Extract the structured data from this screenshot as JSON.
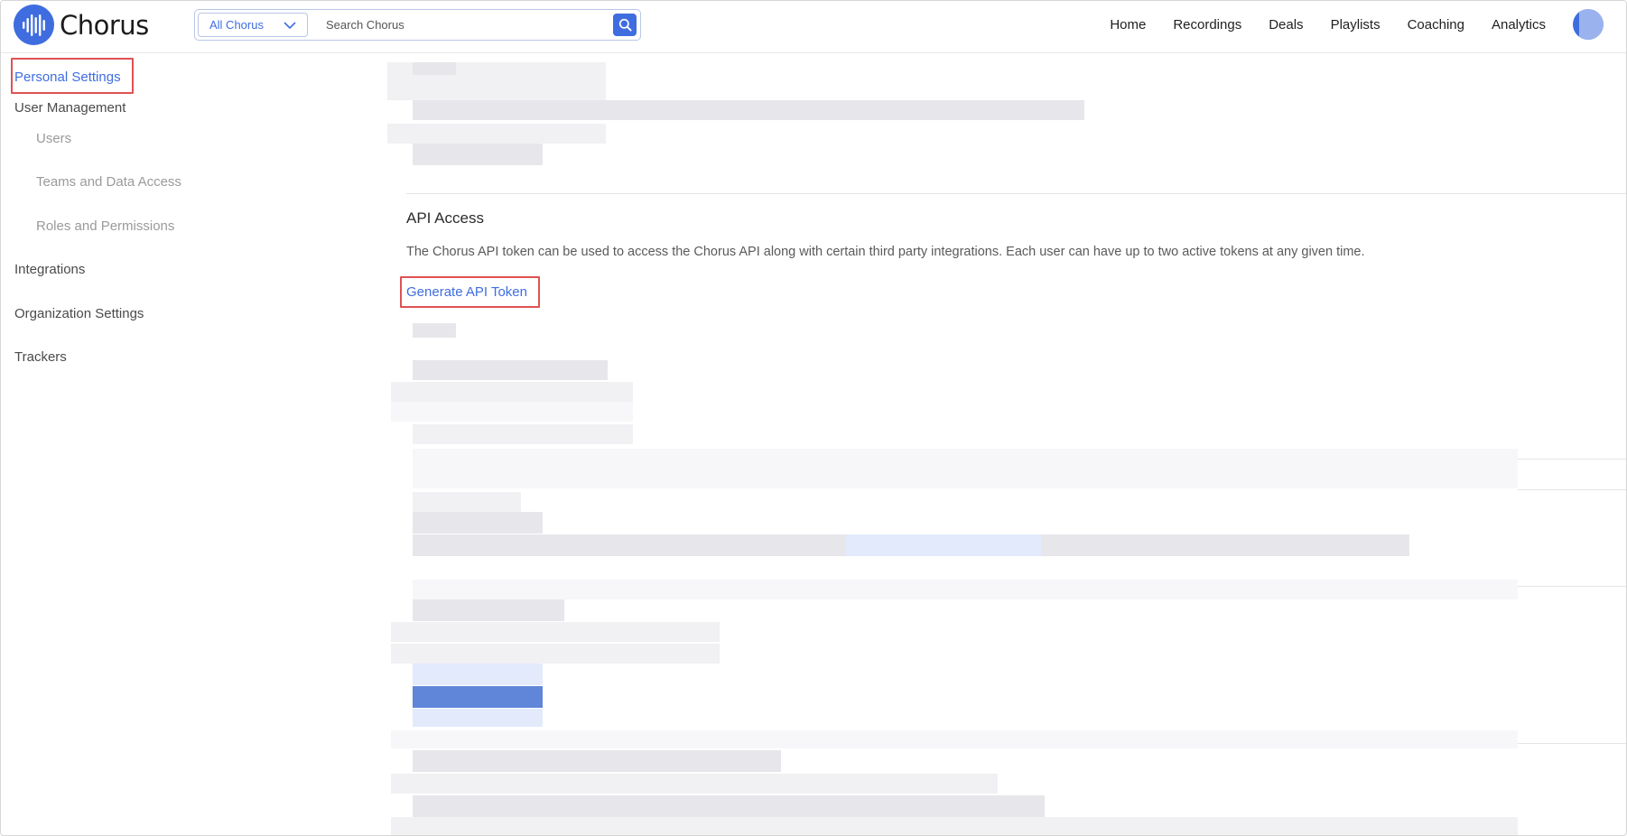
{
  "app": {
    "brand": "Chorus",
    "brand_color": "#3f6de0"
  },
  "header": {
    "search_scope": "All Chorus",
    "search_placeholder": "Search Chorus",
    "nav": [
      {
        "label": "Home"
      },
      {
        "label": "Recordings"
      },
      {
        "label": "Deals"
      },
      {
        "label": "Playlists"
      },
      {
        "label": "Coaching"
      },
      {
        "label": "Analytics"
      }
    ]
  },
  "sidebar": {
    "items": [
      {
        "label": "Personal Settings",
        "active": true
      },
      {
        "label": "User Management"
      },
      {
        "label": "Users"
      },
      {
        "label": "Teams and Data Access"
      },
      {
        "label": "Roles and Permissions"
      },
      {
        "label": "Integrations"
      },
      {
        "label": "Organization Settings"
      },
      {
        "label": "Trackers"
      }
    ]
  },
  "api_access": {
    "title": "API Access",
    "description": "The Chorus API token can be used to access the Chorus API along with certain third party integrations. Each user can have up to two active tokens at any given time.",
    "generate_label": "Generate API Token"
  },
  "icons": {
    "logo": "sound-wave-icon",
    "scope_dropdown": "chevron-down-icon",
    "search": "search-icon",
    "avatar": "user-avatar"
  }
}
